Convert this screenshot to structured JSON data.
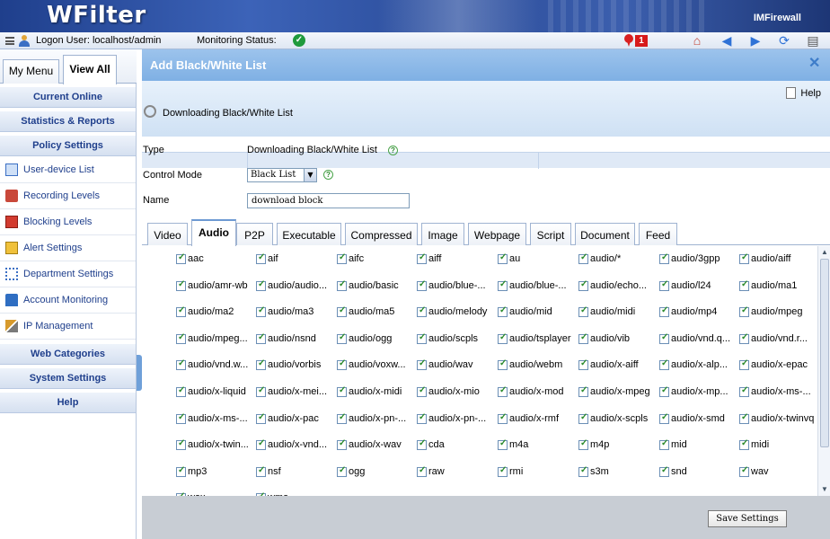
{
  "banner": {
    "logo": "WFilter",
    "brand": "IMFirewall"
  },
  "status": {
    "logon_label": "Logon User: localhost/admin",
    "monitor_label": "Monitoring Status:",
    "alert_count": "1"
  },
  "sidebar": {
    "tabs": [
      "My Menu",
      "View All"
    ],
    "current_online": "Current Online",
    "statistics": "Statistics & Reports",
    "policy": "Policy Settings",
    "policy_items": [
      "User-device List",
      "Recording Levels",
      "Blocking Levels",
      "Alert Settings",
      "Department Settings",
      "Account Monitoring",
      "IP Management"
    ],
    "web_categories": "Web Categories",
    "system_settings": "System Settings",
    "help": "Help"
  },
  "main": {
    "title": "Add Black/White List",
    "help": "Help",
    "header_title": "Downloading Black/White List",
    "type_label": "Type",
    "type_value": "Downloading Black/White List",
    "mode_label": "Control Mode",
    "mode_value": "Black List",
    "name_label": "Name",
    "name_value": "download block",
    "tabs": [
      "Video",
      "Audio",
      "P2P",
      "Executable",
      "Compressed",
      "Image",
      "Webpage",
      "Script",
      "Document",
      "Feed"
    ],
    "active_tab": "Audio",
    "mime_types": [
      "aac",
      "aif",
      "aifc",
      "aiff",
      "au",
      "audio/*",
      "audio/3gpp",
      "audio/aiff",
      "audio/amr-wb",
      "audio/audio...",
      "audio/basic",
      "audio/blue-...",
      "audio/blue-...",
      "audio/echo...",
      "audio/l24",
      "audio/ma1",
      "audio/ma2",
      "audio/ma3",
      "audio/ma5",
      "audio/melody",
      "audio/mid",
      "audio/midi",
      "audio/mp4",
      "audio/mpeg",
      "audio/mpeg...",
      "audio/nsnd",
      "audio/ogg",
      "audio/scpls",
      "audio/tsplayer",
      "audio/vib",
      "audio/vnd.q...",
      "audio/vnd.r...",
      "audio/vnd.w...",
      "audio/vorbis",
      "audio/voxw...",
      "audio/wav",
      "audio/webm",
      "audio/x-aiff",
      "audio/x-alp...",
      "audio/x-epac",
      "audio/x-liquid",
      "audio/x-mei...",
      "audio/x-midi",
      "audio/x-mio",
      "audio/x-mod",
      "audio/x-mpeg",
      "audio/x-mp...",
      "audio/x-ms-...",
      "audio/x-ms-...",
      "audio/x-pac",
      "audio/x-pn-...",
      "audio/x-pn-...",
      "audio/x-rmf",
      "audio/x-scpls",
      "audio/x-smd",
      "audio/x-twinvq",
      "audio/x-twin...",
      "audio/x-vnd...",
      "audio/x-wav",
      "cda",
      "m4a",
      "m4p",
      "mid",
      "midi",
      "mp3",
      "nsf",
      "ogg",
      "raw",
      "rmi",
      "s3m",
      "snd",
      "wav",
      "wax",
      "wma"
    ],
    "save": "Save Settings"
  }
}
